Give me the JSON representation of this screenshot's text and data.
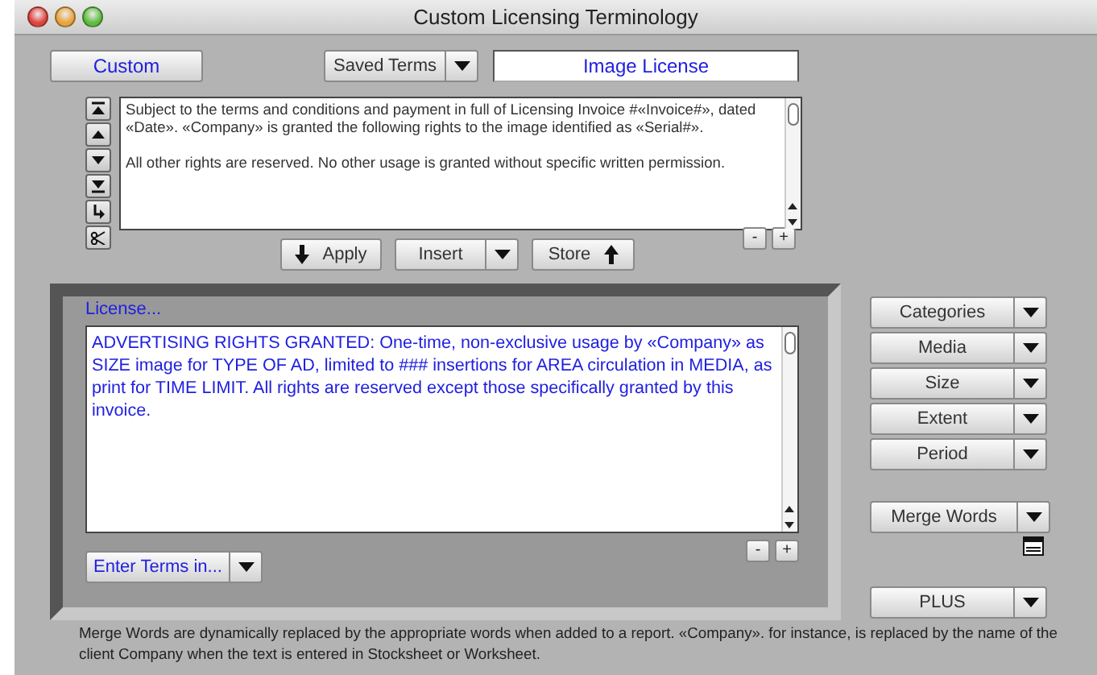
{
  "window": {
    "title": "Custom Licensing Terminology"
  },
  "custom_button": {
    "label": "Custom"
  },
  "saved_terms": {
    "label": "Saved Terms"
  },
  "term_name": {
    "value": "Image License"
  },
  "terms_text": {
    "paragraphs": [
      "Subject to the terms and conditions and payment in full of Licensing Invoice #«Invoice#», dated «Date».  «Company» is granted the following rights to the image identified as «Serial#».",
      "All other rights are reserved. No other usage is granted without specific written permission."
    ],
    "size_buttons": [
      "-",
      "+"
    ]
  },
  "actions": [
    {
      "kind": "apply",
      "label": "Apply"
    },
    {
      "kind": "menu",
      "label": "Insert"
    },
    {
      "kind": "store",
      "label": "Store"
    }
  ],
  "license": {
    "label": "License...",
    "text": "ADVERTISING RIGHTS GRANTED:  One-time, non-exclusive usage by «Company» as SIZE image for TYPE OF AD, limited to ### insertions for AREA circulation in MEDIA, as print for TIME LIMIT. All rights are reserved except those specifically granted by this invoice.",
    "size_buttons": [
      "-",
      "+"
    ]
  },
  "enter_terms": {
    "label": "Enter Terms in..."
  },
  "menus": [
    {
      "label": "Categories"
    },
    {
      "label": "Media"
    },
    {
      "label": "Size"
    },
    {
      "label": "Extent"
    },
    {
      "label": "Period"
    }
  ],
  "merge_words": {
    "label": "Merge Words"
  },
  "plus": {
    "label": "PLUS"
  },
  "footnote": "Merge Words are dynamically replaced by the appropriate words when added to a report. «Company». for instance, is replaced by the name of the client Company when the text is entered in Stocksheet or Worksheet."
}
